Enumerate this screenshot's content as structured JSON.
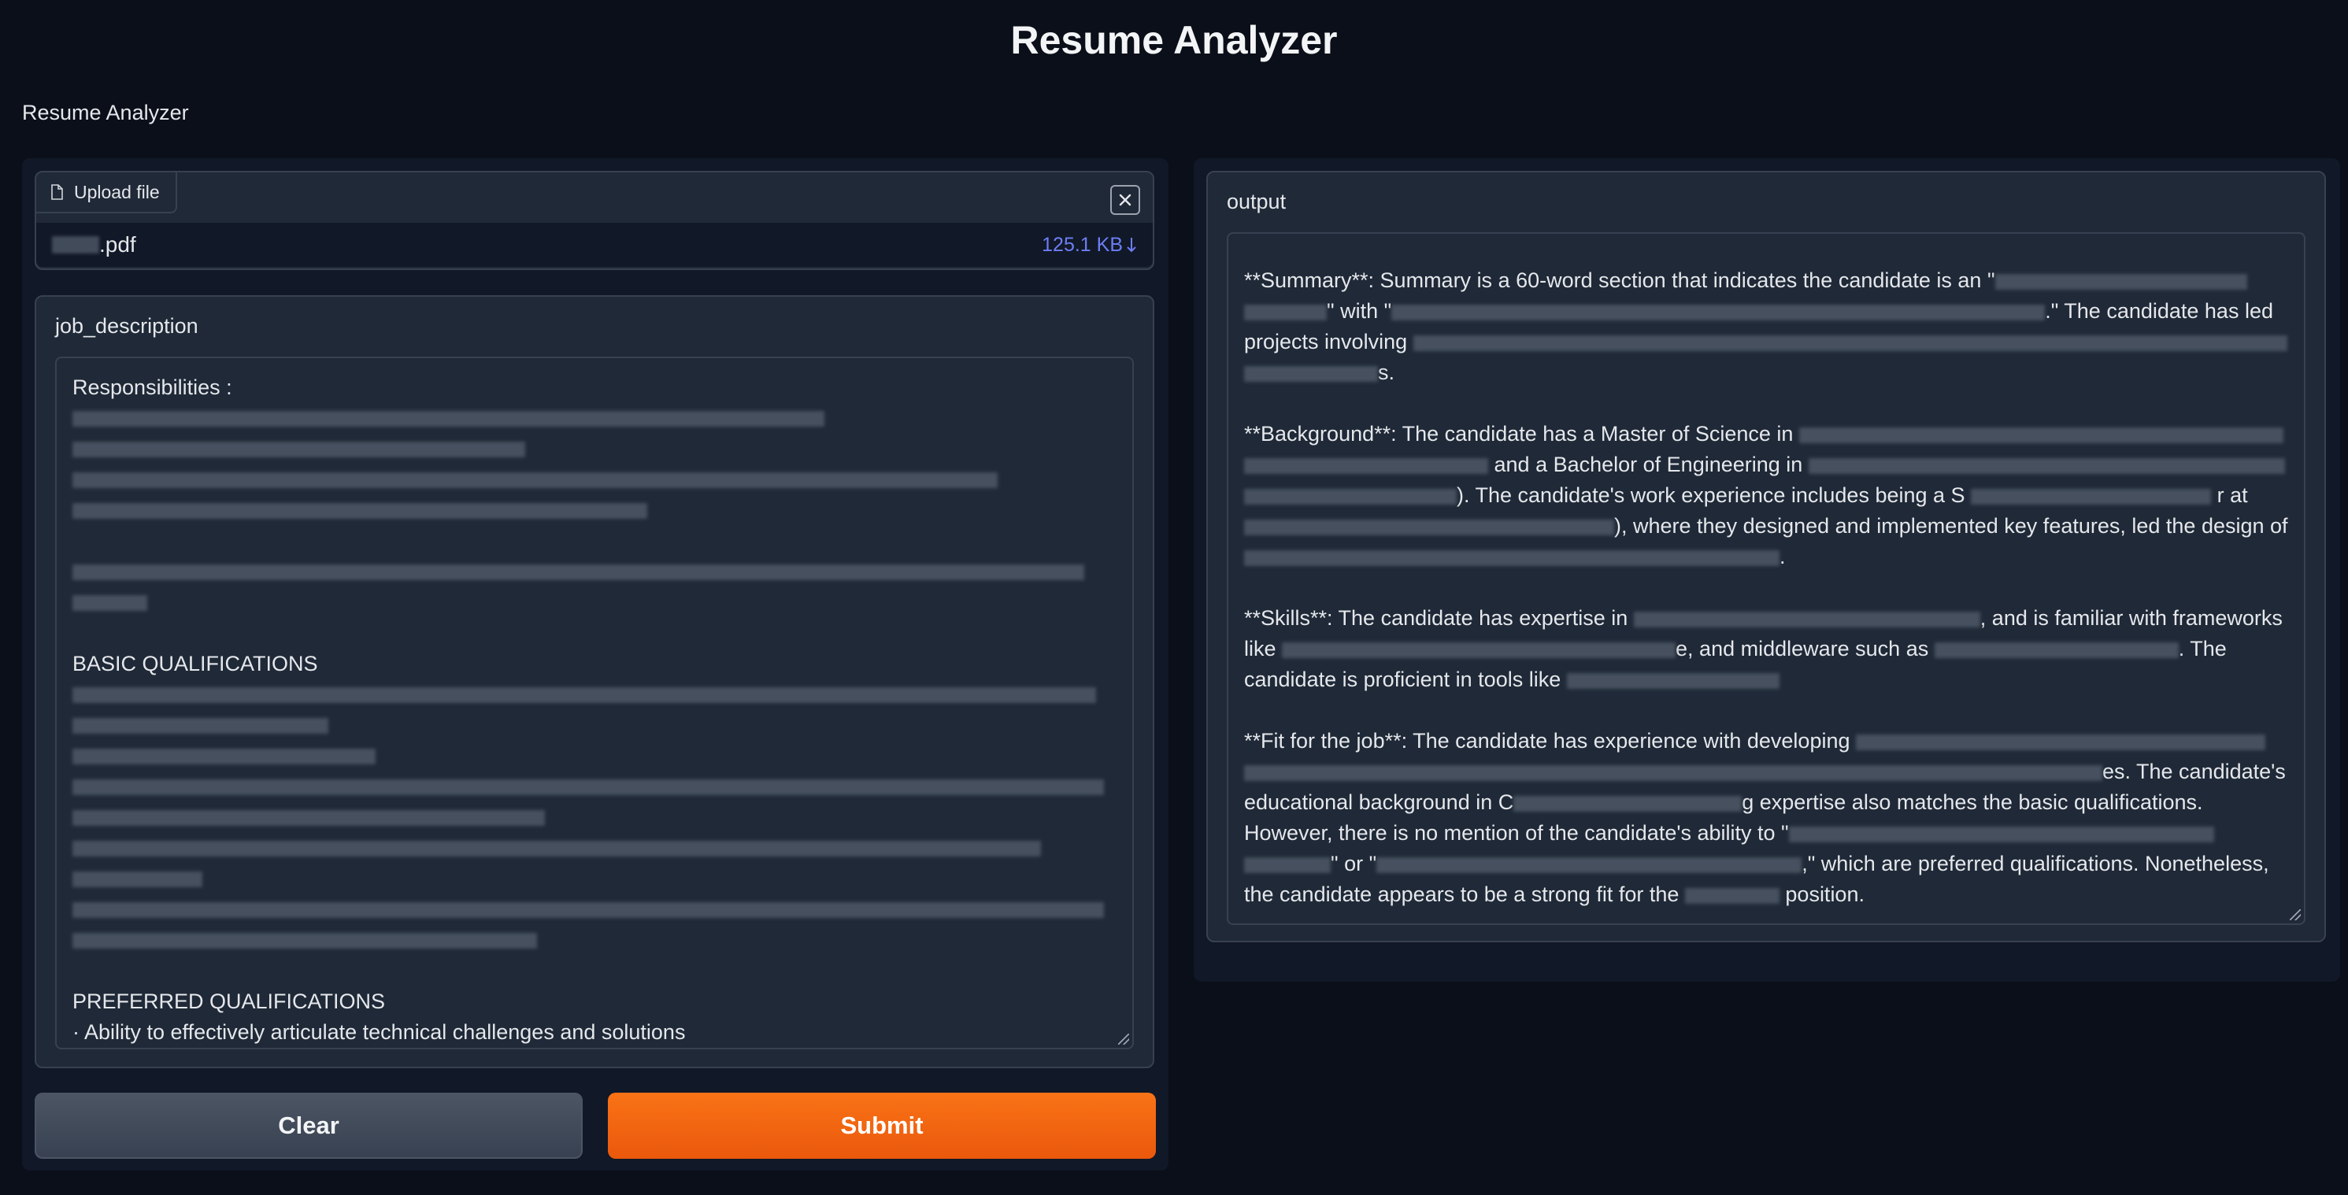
{
  "app": {
    "title": "Resume Analyzer",
    "subtitle": "Resume Analyzer"
  },
  "upload": {
    "tab_label": "Upload file",
    "file_name_suffix": ".pdf",
    "file_size": "125.1 KB",
    "file_size_icon": "download-arrow-icon"
  },
  "job_description": {
    "label": "job_description",
    "responsibilities_heading": "Responsibilities :",
    "basic_heading": "BASIC QUALIFICATIONS",
    "preferred_heading": "PREFERRED QUALIFICATIONS",
    "last_line": "· Ability to effectively articulate technical challenges and solutions"
  },
  "buttons": {
    "clear_label": "Clear",
    "submit_label": "Submit"
  },
  "output": {
    "label": "output",
    "summary": {
      "p1": "**Summary**: Summary is a 60-word section that indicates the candidate is an \"",
      "p2": "\" with \"",
      "p3": ".\" The candidate has led",
      "p4": "projects involving",
      "p5": "s."
    },
    "background": {
      "p1": "**Background**: The candidate has a Master of Science in",
      "p2": "and a Bachelor of Engineering in",
      "p3": "). The candidate's work experience includes being a S",
      "p4": "r at",
      "p5": "), where they designed and implemented key features, led the design of"
    },
    "skills": {
      "p1": "**Skills**: The candidate has expertise in",
      "p2": ", and is familiar with frameworks",
      "p3": "like",
      "p4": "e, and middleware such as",
      "p5": ". The",
      "p6": "candidate is proficient in tools like"
    },
    "fit": {
      "p1": "**Fit for the job**: The candidate has experience with developing",
      "p2": "es. The candidate's",
      "p3": "educational background in C",
      "p4": "g expertise also matches the basic qualifications.",
      "p5": "However, there is no mention of the candidate's ability to \"",
      "p6": "\" or \"",
      "p7": ",\" which are preferred qualifications. Nonetheless,",
      "p8": "the candidate appears to be a strong fit for the",
      "p9": "position."
    }
  },
  "colors": {
    "background": "#0b0f19",
    "panel": "#1f2937",
    "accent": "#f97316",
    "link": "#6d7ef5"
  }
}
